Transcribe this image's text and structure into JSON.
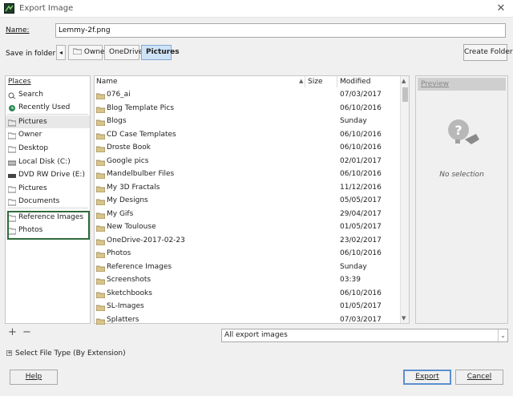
{
  "window": {
    "title": "Export Image",
    "close_glyph": "✕"
  },
  "name_row": {
    "label": "Name:",
    "value": "Lemmy-2f.png"
  },
  "save_row": {
    "label": "Save in folder:",
    "breadcrumbs": [
      {
        "label": "Owner",
        "active": false
      },
      {
        "label": "OneDrive",
        "active": false
      },
      {
        "label": "Pictures",
        "active": true
      }
    ],
    "create_folder": "Create Folder"
  },
  "places": {
    "header": "Places",
    "items": [
      {
        "label": "Search",
        "icon": "search-icon"
      },
      {
        "label": "Recently Used",
        "icon": "recent-icon"
      },
      {
        "label": "Pictures",
        "icon": "folder-icon",
        "selected": true
      },
      {
        "label": "Owner",
        "icon": "folder-icon"
      },
      {
        "label": "Desktop",
        "icon": "folder-icon"
      },
      {
        "label": "Local Disk (C:)",
        "icon": "drive-icon"
      },
      {
        "label": "DVD RW Drive (E:)",
        "icon": "dvd-icon"
      },
      {
        "label": "Pictures",
        "icon": "folder-icon"
      },
      {
        "label": "Documents",
        "icon": "folder-icon"
      },
      {
        "label": "Reference Images",
        "icon": "folder-icon"
      },
      {
        "label": "Photos",
        "icon": "folder-icon"
      }
    ],
    "add_glyph": "+",
    "remove_glyph": "−"
  },
  "files": {
    "columns": {
      "name": "Name",
      "size": "Size",
      "modified": "Modified"
    },
    "rows": [
      {
        "name": "076_ai",
        "modified": "07/03/2017"
      },
      {
        "name": "Blog Template Pics",
        "modified": "06/10/2016"
      },
      {
        "name": "Blogs",
        "modified": "Sunday"
      },
      {
        "name": "CD Case Templates",
        "modified": "06/10/2016"
      },
      {
        "name": "Droste Book",
        "modified": "06/10/2016"
      },
      {
        "name": "Google pics",
        "modified": "02/01/2017"
      },
      {
        "name": "Mandelbulber Files",
        "modified": "06/10/2016"
      },
      {
        "name": "My 3D Fractals",
        "modified": "11/12/2016"
      },
      {
        "name": "My Designs",
        "modified": "05/05/2017"
      },
      {
        "name": "My Gifs",
        "modified": "29/04/2017"
      },
      {
        "name": "New Toulouse",
        "modified": "01/05/2017"
      },
      {
        "name": "OneDrive-2017-02-23",
        "modified": "23/02/2017"
      },
      {
        "name": "Photos",
        "modified": "06/10/2016"
      },
      {
        "name": "Reference Images",
        "modified": "Sunday"
      },
      {
        "name": "Screenshots",
        "modified": "03:39"
      },
      {
        "name": "Sketchbooks",
        "modified": "06/10/2016"
      },
      {
        "name": "SL-Images",
        "modified": "01/05/2017"
      },
      {
        "name": "Splatters",
        "modified": "07/03/2017"
      }
    ]
  },
  "preview": {
    "header": "Preview",
    "empty_text": "No selection"
  },
  "filter": {
    "value": "All export images"
  },
  "file_type": {
    "label": "Select File Type (By Extension)",
    "expander": "+"
  },
  "buttons": {
    "help": "Help",
    "export": "Export",
    "cancel": "Cancel"
  },
  "colors": {
    "selected_crumb": "#cfe3f7",
    "bookmark_border": "#2e6b3a",
    "default_button_border": "#5b8fce",
    "folder": "#d9c48a"
  }
}
